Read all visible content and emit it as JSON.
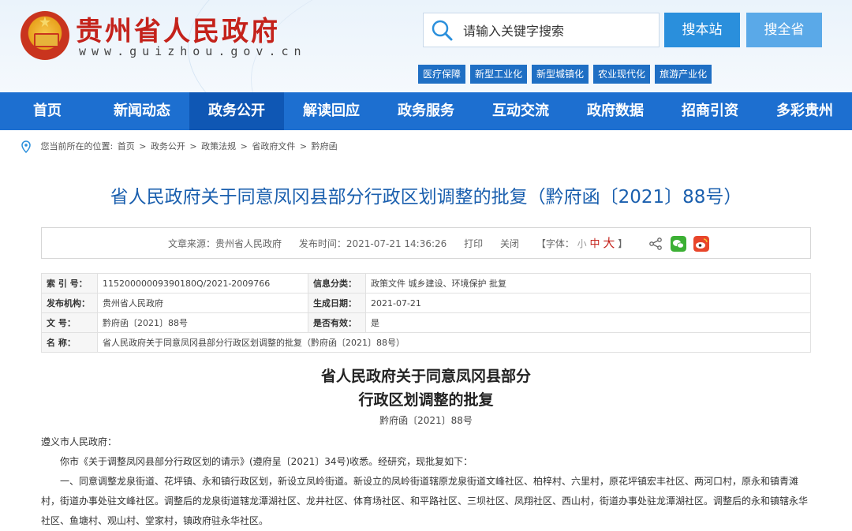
{
  "header": {
    "site_title": "贵州省人民政府",
    "site_url": "www.guizhou.gov.cn",
    "search_placeholder": "请输入关键字搜索",
    "btn_site": "搜本站",
    "btn_province": "搜全省",
    "tags": [
      "医疗保障",
      "新型工业化",
      "新型城镇化",
      "农业现代化",
      "旅游产业化"
    ],
    "colors": {
      "brand_red": "#c4221b",
      "nav_blue": "#1d6fd0",
      "nav_active": "#0f57b4"
    }
  },
  "nav": {
    "items": [
      "首页",
      "新闻动态",
      "政务公开",
      "解读回应",
      "政务服务",
      "互动交流",
      "政府数据",
      "招商引资",
      "多彩贵州"
    ],
    "active": "政务公开"
  },
  "breadcrumb": {
    "prefix": "您当前所在的位置:",
    "items": [
      "首页",
      "政务公开",
      "政策法规",
      "省政府文件",
      "黔府函"
    ]
  },
  "article": {
    "title": "省人民政府关于同意凤冈县部分行政区划调整的批复（黔府函〔2021〕88号）",
    "meta": {
      "source": "文章来源：贵州省人民政府",
      "date": "发布时间：2021-07-21 14:36:26",
      "print": "打印",
      "close": "关闭",
      "font_label": "【字体：",
      "font_small": "小",
      "font_mid": "中",
      "font_big": "大",
      "font_end": "】"
    }
  },
  "info_table": {
    "index_label": "索 引 号：",
    "index_value": "11520000009390180Q/2021-2009766",
    "category_label": "信息分类：",
    "category_value": "政策文件   城乡建设、环境保护   批复",
    "issuer_label": "发布机构：",
    "issuer_value": "贵州省人民政府",
    "date_label": "生成日期：",
    "date_value": "2021-07-21",
    "docno_label": "文    号：",
    "docno_value": "黔府函〔2021〕88号",
    "valid_label": "是否有效：",
    "valid_value": "是",
    "name_label": "名    称：",
    "name_value": "省人民政府关于同意凤冈县部分行政区划调整的批复（黔府函〔2021〕88号）"
  },
  "document": {
    "title_line1": "省人民政府关于同意凤冈县部分",
    "title_line2": "行政区划调整的批复",
    "doc_no": "黔府函〔2021〕88号",
    "salutation": "遵义市人民政府：",
    "para1": "你市《关于调整凤冈县部分行政区划的请示》(遵府呈〔2021〕34号)收悉。经研究，现批复如下：",
    "para2": "一、同意调整龙泉街道、花坪镇、永和镇行政区划，新设立凤岭街道。新设立的凤岭街道辖原龙泉街道文峰社区、柏梓村、六里村，原花坪镇宏丰社区、两河口村，原永和镇青滩村，街道办事处驻文峰社区。调整后的龙泉街道辖龙潭湖社区、龙井社区、体育场社区、和平路社区、三坝社区、凤翔社区、西山村，街道办事处驻龙潭湖社区。调整后的永和镇辖永华社区、鱼塘村、观山村、堂家村，镇政府驻永华社区。"
  }
}
